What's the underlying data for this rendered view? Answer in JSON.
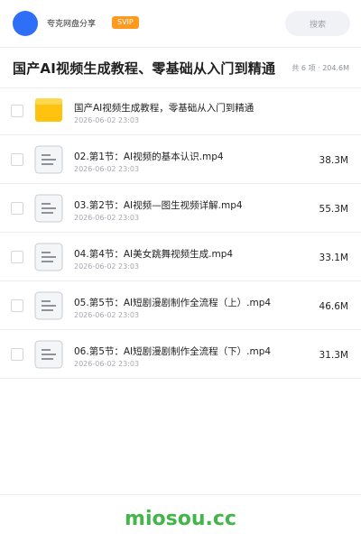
{
  "header": {
    "uploader_name": "夸克网盘分享",
    "badge": "SVIP",
    "search_label": "搜索"
  },
  "folder": {
    "title": "国产AI视频生成教程、零基础从入门到精通",
    "meta": "共 6 项 · 204.6M"
  },
  "files": [
    {
      "name": "国产AI视频生成教程，零基础从入门到精通",
      "date": "2026-06-02 23:03",
      "size": "",
      "type": "folder-icon"
    },
    {
      "name": "02.第1节：AI视频的基本认识.mp4",
      "date": "2026-06-02 23:03",
      "size": "38.3M",
      "type": "file-icon"
    },
    {
      "name": "03.第2节：AI视频—图生视频详解.mp4",
      "date": "2026-06-02 23:03",
      "size": "55.3M",
      "type": "file-icon"
    },
    {
      "name": "04.第4节：AI美女跳舞视频生成.mp4",
      "date": "2026-06-02 23:03",
      "size": "33.1M",
      "type": "file-icon"
    },
    {
      "name": "05.第5节：AI短剧漫剧制作全流程（上）.mp4",
      "date": "2026-06-02 23:03",
      "size": "46.6M",
      "type": "file-icon"
    },
    {
      "name": "06.第5节：AI短剧漫剧制作全流程（下）.mp4",
      "date": "2026-06-02 23:03",
      "size": "31.3M",
      "type": "file-icon"
    }
  ],
  "footer": {
    "watermark": "miosou.cc"
  },
  "colors": {
    "accent": "#2f6ef6",
    "svip": "#ff9a1f",
    "watermark": "#43b54a",
    "folder": "#ffc20e"
  }
}
